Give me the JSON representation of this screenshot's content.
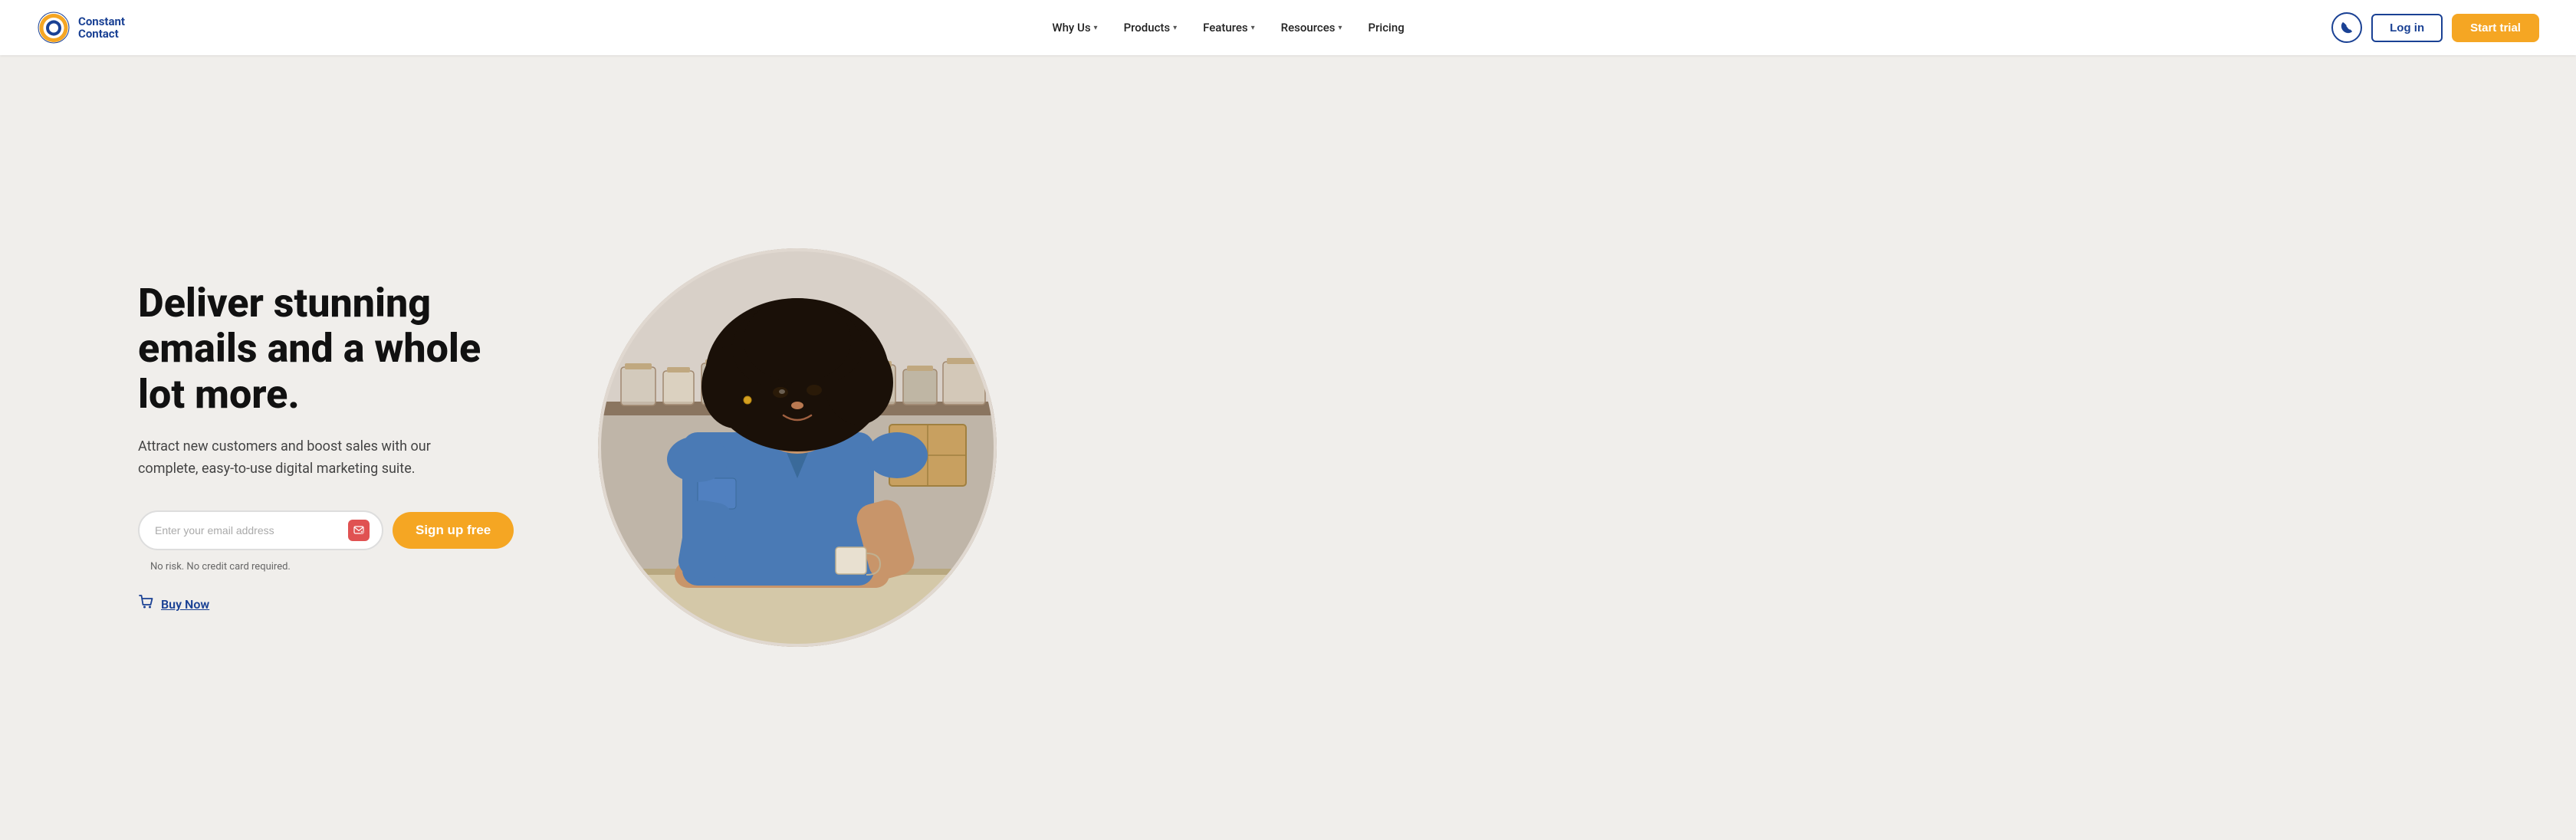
{
  "header": {
    "logo": {
      "line1": "Constant",
      "line2": "Contact"
    },
    "nav": [
      {
        "label": "Why Us",
        "hasDropdown": true,
        "id": "why-us"
      },
      {
        "label": "Products",
        "hasDropdown": true,
        "id": "products"
      },
      {
        "label": "Features",
        "hasDropdown": true,
        "id": "features"
      },
      {
        "label": "Resources",
        "hasDropdown": true,
        "id": "resources"
      },
      {
        "label": "Pricing",
        "hasDropdown": false,
        "id": "pricing"
      }
    ],
    "phone_label": "📞",
    "login_label": "Log in",
    "start_trial_label": "Start trial"
  },
  "hero": {
    "title": "Deliver stunning emails and a whole lot more.",
    "subtitle": "Attract new customers and boost sales with our complete, easy-to-use digital marketing suite.",
    "email_placeholder": "Enter your email address",
    "signup_button": "Sign up free",
    "no_risk_text": "No risk. No credit card required.",
    "buy_now_label": "Buy Now"
  },
  "colors": {
    "primary_blue": "#1a4194",
    "primary_orange": "#f5a623",
    "bg_light": "#f0eeeb",
    "text_dark": "#111111",
    "text_medium": "#444444"
  }
}
